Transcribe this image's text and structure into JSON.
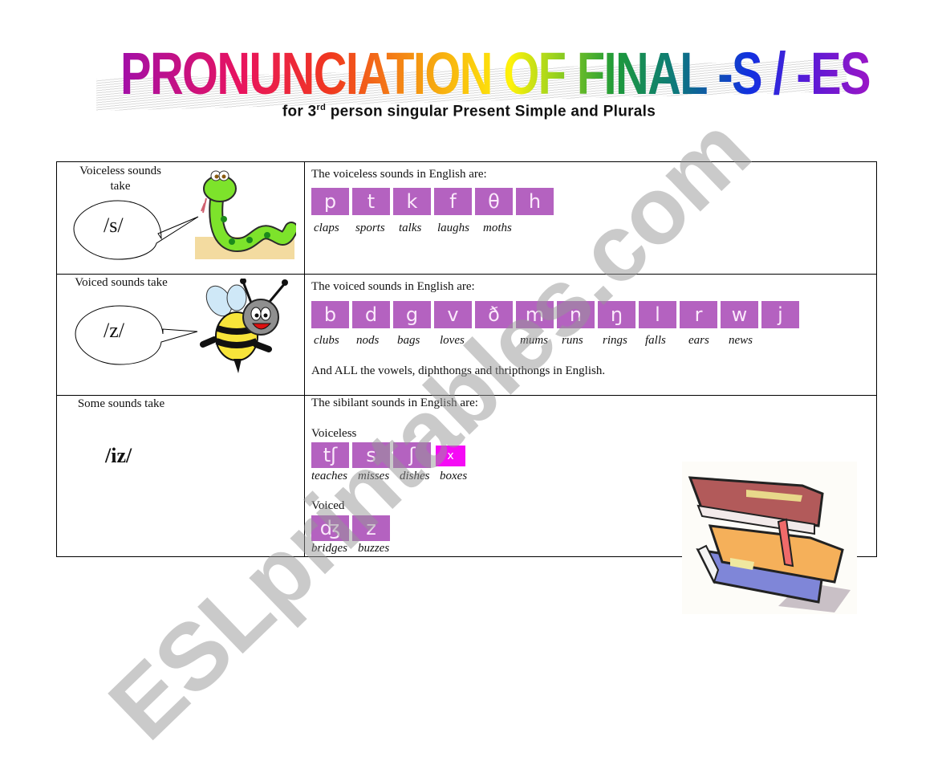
{
  "title": "PRONUNCIATION OF FINAL -S / -ES",
  "subtitle": {
    "prefix": "for 3",
    "sup": "rd",
    "suffix": " person singular Present Simple and Plurals"
  },
  "rows": [
    {
      "left_label": "Voiceless sounds take",
      "sound": "/s/",
      "picture": "snake",
      "heading": "The voiceless sounds in English are:",
      "tiles": [
        "p",
        "t",
        "k",
        "f",
        "θ",
        "h"
      ],
      "words": [
        "claps",
        "sports",
        "talks",
        "laughs",
        "moths"
      ]
    },
    {
      "left_label": "Voiced sounds take",
      "sound": "/z/",
      "picture": "bee",
      "heading": "The voiced sounds in English are:",
      "tiles": [
        "b",
        "d",
        "g",
        "v",
        "ð",
        "m",
        "n",
        "ŋ",
        "l",
        "r",
        "w",
        "j"
      ],
      "words": [
        "clubs",
        "nods",
        "bags",
        "loves",
        "",
        "mums",
        "runs",
        "rings",
        "falls",
        "ears",
        "news"
      ],
      "note": "And ALL the vowels, diphthongs and thripthongs in English."
    },
    {
      "left_label": "Some sounds take",
      "sound": "/iz/",
      "picture": "books",
      "heading": "The sibilant sounds in English are:",
      "groups": [
        {
          "label": "Voiceless",
          "tiles": [
            "tʃ",
            "s",
            "ʃ",
            "x"
          ],
          "words": [
            "teaches",
            "misses",
            "dishes",
            "boxes"
          ]
        },
        {
          "label": "Voiced",
          "tiles": [
            "ʤ",
            "z"
          ],
          "words": [
            "bridges",
            "buzzes"
          ]
        }
      ]
    }
  ],
  "colors": {
    "tile": "#b462c0",
    "tile_highlight": "#f50af5"
  },
  "watermark": "ESLprintables.com"
}
